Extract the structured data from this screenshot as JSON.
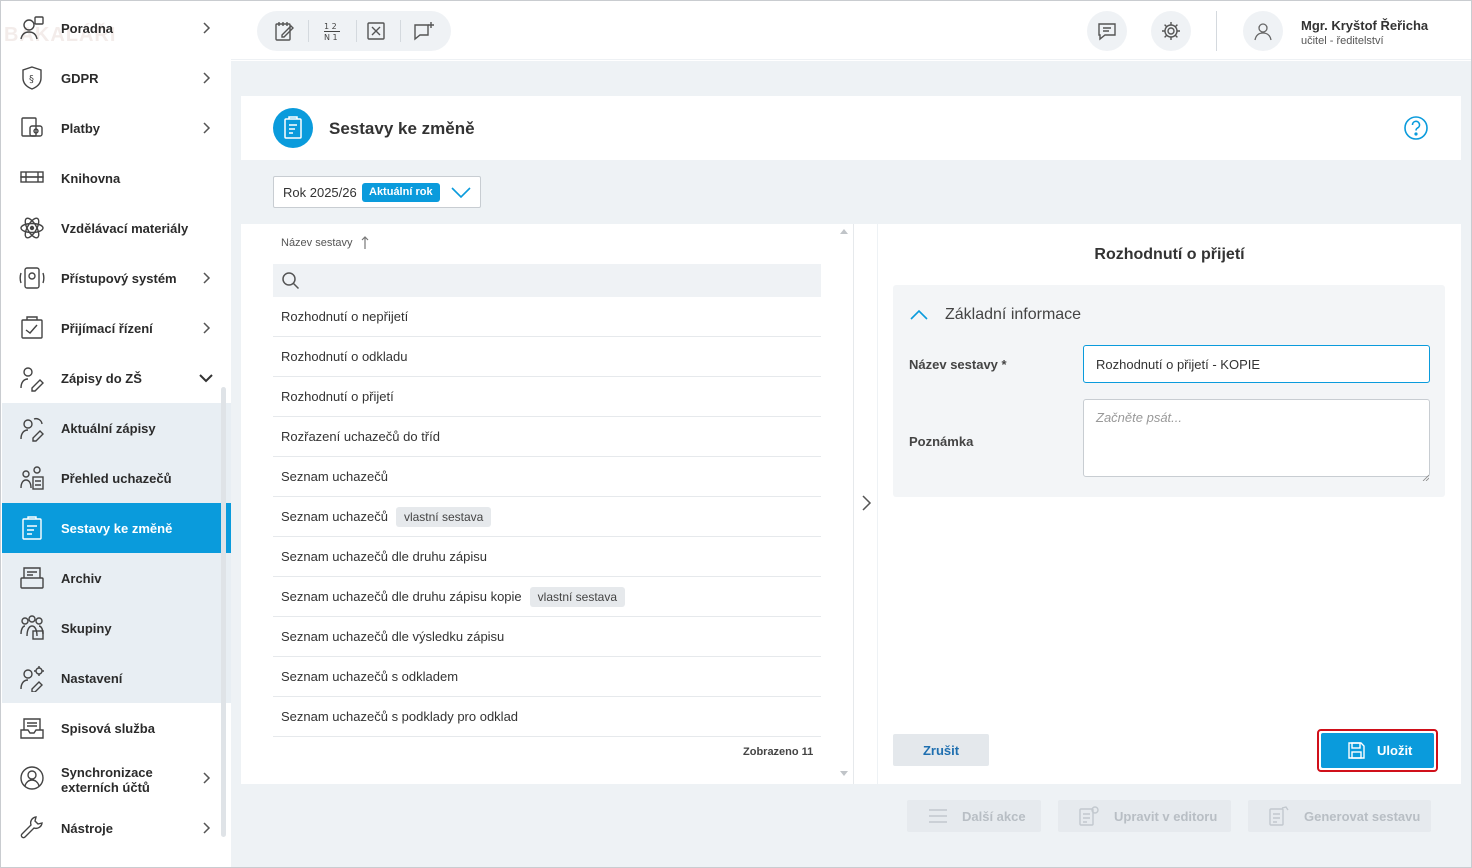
{
  "sidebar": {
    "logo_ghost": "BAKALÁŘI",
    "items": [
      {
        "label": "Poradna",
        "has_chevron": true
      },
      {
        "label": "GDPR",
        "has_chevron": true
      },
      {
        "label": "Platby",
        "has_chevron": true
      },
      {
        "label": "Knihovna",
        "has_chevron": false
      },
      {
        "label": "Vzdělávací materiály",
        "has_chevron": false
      },
      {
        "label": "Přístupový systém",
        "has_chevron": true
      },
      {
        "label": "Přijímací řízení",
        "has_chevron": true
      },
      {
        "label": "Zápisy do ZŠ",
        "has_chevron": true,
        "expanded": true
      },
      {
        "label": "Aktuální zápisy",
        "sub": true
      },
      {
        "label": "Přehled uchazečů",
        "sub": true
      },
      {
        "label": "Sestavy ke změně",
        "sub": true,
        "active": true
      },
      {
        "label": "Archiv",
        "sub": true
      },
      {
        "label": "Skupiny",
        "sub": true
      },
      {
        "label": "Nastavení",
        "sub": true
      },
      {
        "label": "Spisová služba",
        "has_chevron": false
      },
      {
        "label": "Synchronizace",
        "label2": "externích účtů",
        "has_chevron": true
      },
      {
        "label": "Nástroje",
        "has_chevron": true
      }
    ]
  },
  "topbar": {
    "user_name": "Mgr. Kryštof Řeřicha",
    "user_role": "učitel - ředitelství",
    "numbers_icon_top": "1 2",
    "numbers_icon_bottom": "N 1"
  },
  "page": {
    "title": "Sestavy ke změně",
    "year_label": "Rok 2025/26",
    "year_badge": "Aktuální rok"
  },
  "list": {
    "column_header": "Název sestavy",
    "rows": [
      {
        "name": "Rozhodnutí o nepřijetí",
        "tag": ""
      },
      {
        "name": "Rozhodnutí o odkladu",
        "tag": ""
      },
      {
        "name": "Rozhodnutí o přijetí",
        "tag": ""
      },
      {
        "name": "Rozřazení uchazečů do tříd",
        "tag": ""
      },
      {
        "name": "Seznam uchazečů",
        "tag": ""
      },
      {
        "name": "Seznam uchazečů",
        "tag": "vlastní sestava"
      },
      {
        "name": "Seznam uchazečů dle druhu zápisu",
        "tag": ""
      },
      {
        "name": "Seznam uchazečů dle druhu zápisu kopie",
        "tag": "vlastní sestava"
      },
      {
        "name": "Seznam uchazečů dle výsledku zápisu",
        "tag": ""
      },
      {
        "name": "Seznam uchazečů s odkladem",
        "tag": ""
      },
      {
        "name": "Seznam uchazečů s podklady pro odklad",
        "tag": ""
      }
    ],
    "count_label": "Zobrazeno 11"
  },
  "detail": {
    "title": "Rozhodnutí o přijetí",
    "section_title": "Základní informace",
    "name_label": "Název sestavy *",
    "name_value": "Rozhodnutí o přijetí - KOPIE",
    "note_label": "Poznámka",
    "note_placeholder": "Začněte psát...",
    "cancel_label": "Zrušit",
    "save_label": "Uložit"
  },
  "actions": {
    "more_label": "Další akce",
    "edit_label": "Upravit v editoru",
    "generate_label": "Generovat sestavu"
  },
  "colors": {
    "accent": "#0a9bdc",
    "highlight": "#d0101a"
  }
}
